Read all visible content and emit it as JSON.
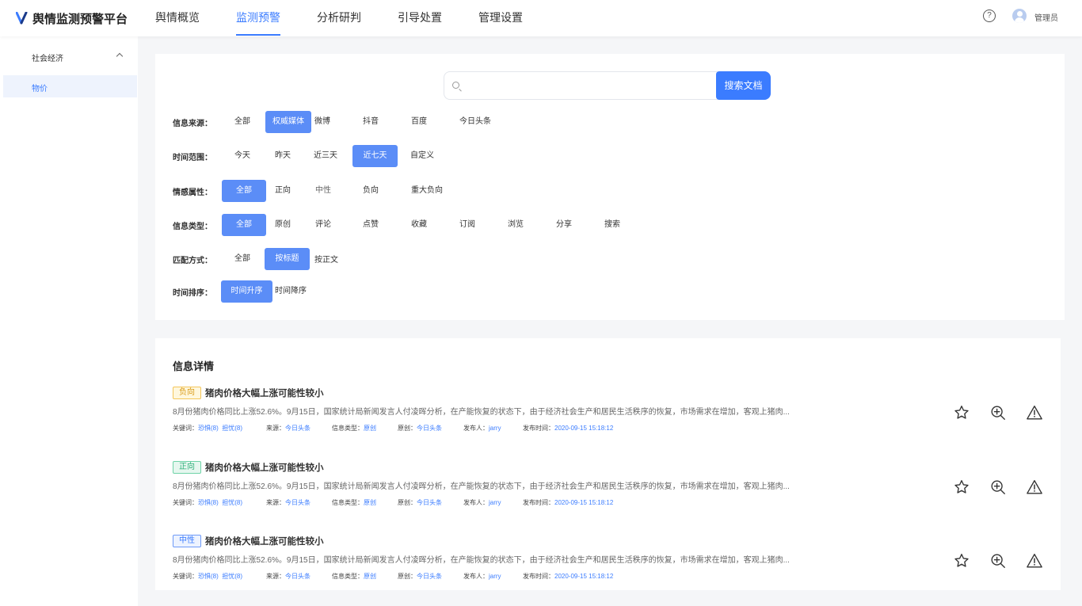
{
  "header": {
    "logo_text": "舆情监测预警平台",
    "nav": [
      "舆情概览",
      "监测预警",
      "分析研判",
      "引导处置",
      "管理设置"
    ],
    "active_nav": 1,
    "help_label": "?",
    "user_name": "管理员"
  },
  "sidebar": {
    "group": "社会经济",
    "item": "物价"
  },
  "search": {
    "placeholder": "",
    "value": "",
    "button_label": "搜索文档"
  },
  "filters": [
    {
      "label": "信息来源：",
      "options": [
        "全部",
        "权威媒体",
        "微博",
        "抖音",
        "百度",
        "今日头条"
      ],
      "selected": 1
    },
    {
      "label": "时间范围：",
      "options": [
        "今天",
        "昨天",
        "近三天",
        "近七天",
        "自定义"
      ],
      "selected": 3
    },
    {
      "label": "情感属性：",
      "options": [
        "全部",
        "正向",
        "中性",
        "负向",
        "重大负向"
      ],
      "selected": 0
    },
    {
      "label": "信息类型：",
      "options": [
        "全部",
        "原创",
        "评论",
        "点赞",
        "收藏",
        "订阅",
        "浏览",
        "分享",
        "搜索"
      ],
      "selected": 0
    },
    {
      "label": "匹配方式：",
      "options": [
        "全部",
        "按标题",
        "按正文"
      ],
      "selected": 1
    },
    {
      "label": "时间排序：",
      "options": [
        "时间升序",
        "时间降序"
      ],
      "selected": 0
    }
  ],
  "info": {
    "title": "信息详情",
    "meta_labels": {
      "keywords": "关键词：",
      "source": "来源：",
      "type": "信息类型：",
      "original": "原创：",
      "publisher": "发布人：",
      "time": "发布时间："
    },
    "items": [
      {
        "tag": "负向",
        "title": "猪肉价格大幅上涨可能性较小",
        "summary": "8月份猪肉价格同比上涨52.6%。9月15日，国家统计局新闻发言人付凌晖分析，在产能恢复的状态下，由于经济社会生产和居民生活秩序的恢复，市场需求在增加，客观上猪肉...",
        "keyword1": "恐惧(8)",
        "keyword2": "担忧(8)",
        "source": "今日头条",
        "type": "原创",
        "original": "今日头条",
        "publisher": "jarry",
        "time": "2020-09-15 15:18:12"
      },
      {
        "tag": "正向",
        "title": "猪肉价格大幅上涨可能性较小",
        "summary": "8月份猪肉价格同比上涨52.6%。9月15日，国家统计局新闻发言人付凌晖分析，在产能恢复的状态下，由于经济社会生产和居民生活秩序的恢复，市场需求在增加，客观上猪肉...",
        "keyword1": "恐惧(8)",
        "keyword2": "担忧(8)",
        "source": "今日头条",
        "type": "原创",
        "original": "今日头条",
        "publisher": "jarry",
        "time": "2020-09-15 15:18:12"
      },
      {
        "tag": "中性",
        "title": "猪肉价格大幅上涨可能性较小",
        "summary": "8月份猪肉价格同比上涨52.6%。9月15日，国家统计局新闻发言人付凌晖分析，在产能恢复的状态下，由于经济社会生产和居民生活秩序的恢复，市场需求在增加，客观上猪肉...",
        "keyword1": "恐惧(8)",
        "keyword2": "担忧(8)",
        "source": "今日头条",
        "type": "原创",
        "original": "今日头条",
        "publisher": "jarry",
        "time": "2020-09-15 15:18:12"
      }
    ],
    "icons": [
      "star-icon",
      "zoom-in-icon",
      "warning-icon"
    ]
  },
  "colors": {
    "accent": "#3b7cff",
    "selected_option": "#5b8df7",
    "negative_tag": "#d99a15",
    "positive_tag": "#2fb07a",
    "neutral_tag": "#3b7cff"
  }
}
